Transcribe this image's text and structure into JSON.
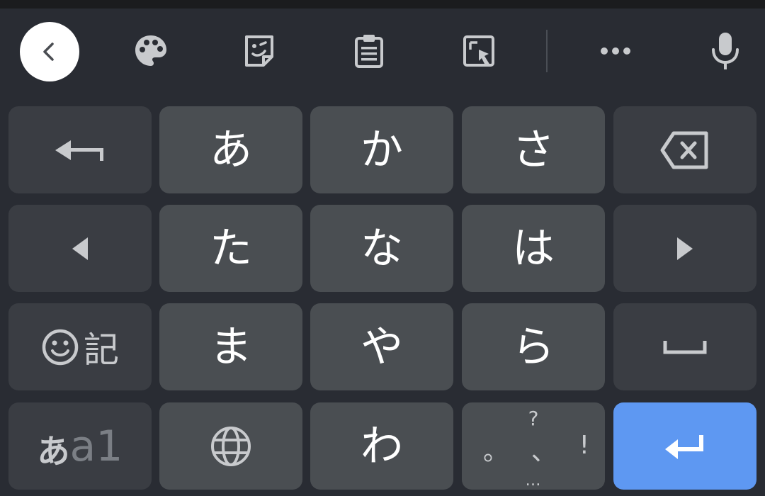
{
  "toolbar": {
    "icons": [
      "back-icon",
      "palette-icon",
      "sticker-icon",
      "clipboard-icon",
      "screenshot-icon",
      "more-icon",
      "microphone-icon"
    ]
  },
  "keys": {
    "undo": {
      "icon": "undo-arrow-icon"
    },
    "a": "あ",
    "ka": "か",
    "sa": "さ",
    "backspace": {
      "icon": "backspace-icon"
    },
    "left": {
      "icon": "left-arrow-icon"
    },
    "ta": "た",
    "na": "な",
    "ha": "は",
    "right": {
      "icon": "right-arrow-icon"
    },
    "emoji_kigo": "記",
    "ma": "ま",
    "ya": "や",
    "ra": "ら",
    "space": {
      "icon": "space-icon"
    },
    "mode": {
      "primary": "あ",
      "secondary": "a1"
    },
    "ha_globe": {
      "icon": "globe-icon"
    },
    "wa": "わ",
    "punct": {
      "top": "?",
      "left": "。",
      "mid": "、",
      "right": "!",
      "bottom": "…"
    },
    "enter": {
      "icon": "enter-icon"
    }
  },
  "colors": {
    "background": "#292c33",
    "char_key": "#4a4e52",
    "func_key": "#3a3d43",
    "enter_key": "#5e98f2",
    "icon": "#c8cacd"
  }
}
